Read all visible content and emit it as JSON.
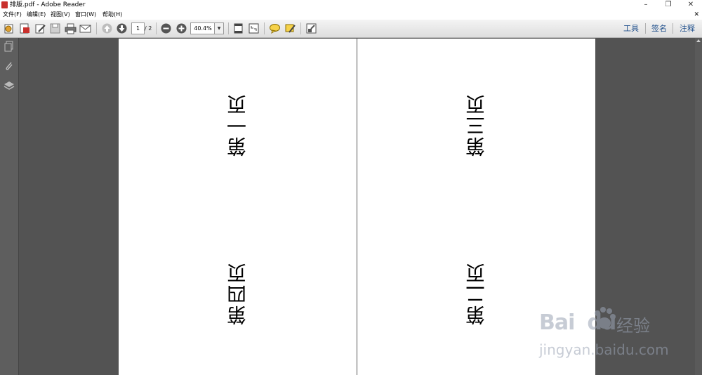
{
  "window": {
    "title": "排版.pdf - Adobe Reader"
  },
  "menu": [
    {
      "label": "文件(F)"
    },
    {
      "label": "编辑(E)"
    },
    {
      "label": "视图(V)"
    },
    {
      "label": "窗口(W)"
    },
    {
      "label": "帮助(H)"
    }
  ],
  "toolbar": {
    "page_current": "1",
    "page_total": "/ 2",
    "zoom": "40.4%",
    "tools_label": "工具",
    "sign_label": "签名",
    "comment_label": "注释"
  },
  "pages": {
    "left_top": "第一页",
    "left_bottom": "第四页",
    "right_top": "第三页",
    "right_bottom": "第二页"
  },
  "watermark": {
    "brand": "Bai",
    "brand2": "du",
    "sub": "经验",
    "url": "jingyan.baidu.com"
  },
  "colors": {
    "accent": "#1f4f8c",
    "doc_bg": "#535353"
  },
  "icons": [
    "open-icon",
    "create-pdf-icon",
    "edit-icon",
    "save-icon",
    "print-icon",
    "email-icon",
    "prev-page-icon",
    "next-page-icon",
    "zoom-out-icon",
    "zoom-in-icon",
    "fit-page-icon",
    "fit-width-icon",
    "comment-icon",
    "highlight-icon",
    "expand-icon",
    "pages-panel-icon",
    "attachments-icon",
    "layers-icon"
  ]
}
